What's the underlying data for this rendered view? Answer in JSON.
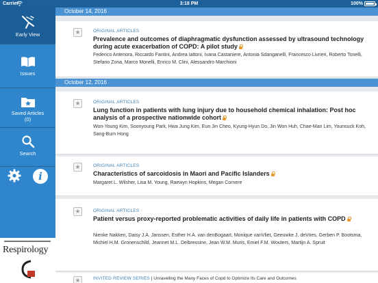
{
  "status_bar": {
    "carrier": "Carrier",
    "time": "3:18 PM",
    "battery": "100%"
  },
  "sidebar": {
    "items": [
      {
        "label": "Early View",
        "icon": "early-view-icon",
        "active": true
      },
      {
        "label": "Issues",
        "icon": "book-icon"
      },
      {
        "label": "Saved Articles",
        "count": "(0)",
        "icon": "saved-folder-icon"
      },
      {
        "label": "Search",
        "icon": "search-icon"
      }
    ],
    "tools": {
      "settings_icon": "gear-icon",
      "info_glyph": "i"
    },
    "logo_text": "Respirology"
  },
  "sections": [
    {
      "date": "October 14, 2016",
      "articles": [
        {
          "type": "ORIGINAL ARTICLES",
          "title": "Prevalence and outcomes of diaphragmatic dysfunction assessed by ultrasound technology during acute exacerbation of COPD: A pilot study",
          "authors": "Federico Antenora, Riccardo Fantini, Andrea Iattoni, Ivana Castaniere, Antonia Sdanganelli, Francesco Livrieri, Roberto Tonelli, Stefano Zona, Marco Monelli, Enrico M. Clini, Alessandro Marchioni",
          "locked": true
        }
      ]
    },
    {
      "date": "October 12, 2016",
      "articles": [
        {
          "type": "ORIGINAL ARTICLES",
          "title": "Lung function in patients with lung injury due to household chemical inhalation: Post hoc analysis of a prospective nationwide cohort",
          "authors": "Won-Young Kim, Soonyoung Park, Hwa Jung Kim, Eun Jin Cheo, Kyung-Hyun Do, Jin Won Huh, Chae-Man Lim, Younsuck Koh, Sang-Bum Hong",
          "locked": true
        },
        {
          "type": "ORIGINAL ARTICLES",
          "title": "Characteristics of sarcoidosis in Maori and Pacific Islanders",
          "authors": "Margaret L. Wilsher, Lisa M. Young, Raewyn Hopkins, Megan Cornere",
          "locked": true
        },
        {
          "type": "ORIGINAL ARTICLES",
          "title": "Patient versus proxy-reported problematic activities of daily life in patients with COPD",
          "authors": "Nienke Nakken, Daisy J.A. Janssen, Esther H.A. van denBogaart, Monique vanVliet, Geeuwke J. deVries, Gerben P. Bootsma, Michiel H.M. Gronenschild, Jeannet M.L. Delbressine, Jean W.M. Muris, Emiel F.M. Wouters, Martijn A. Spruit",
          "locked": true
        },
        {
          "type": "INVITED REVIEW SERIES",
          "title": "Unravelling the Many Faces of Copd to Optimize Its Care and Outcomes"
        }
      ]
    }
  ],
  "colors": {
    "sidebar": "#2f86cc",
    "sidebar_active": "#1b5d96",
    "date_header": "#4b92d3",
    "lock": "#e89b2c",
    "type_label": "#3b7fb8"
  }
}
